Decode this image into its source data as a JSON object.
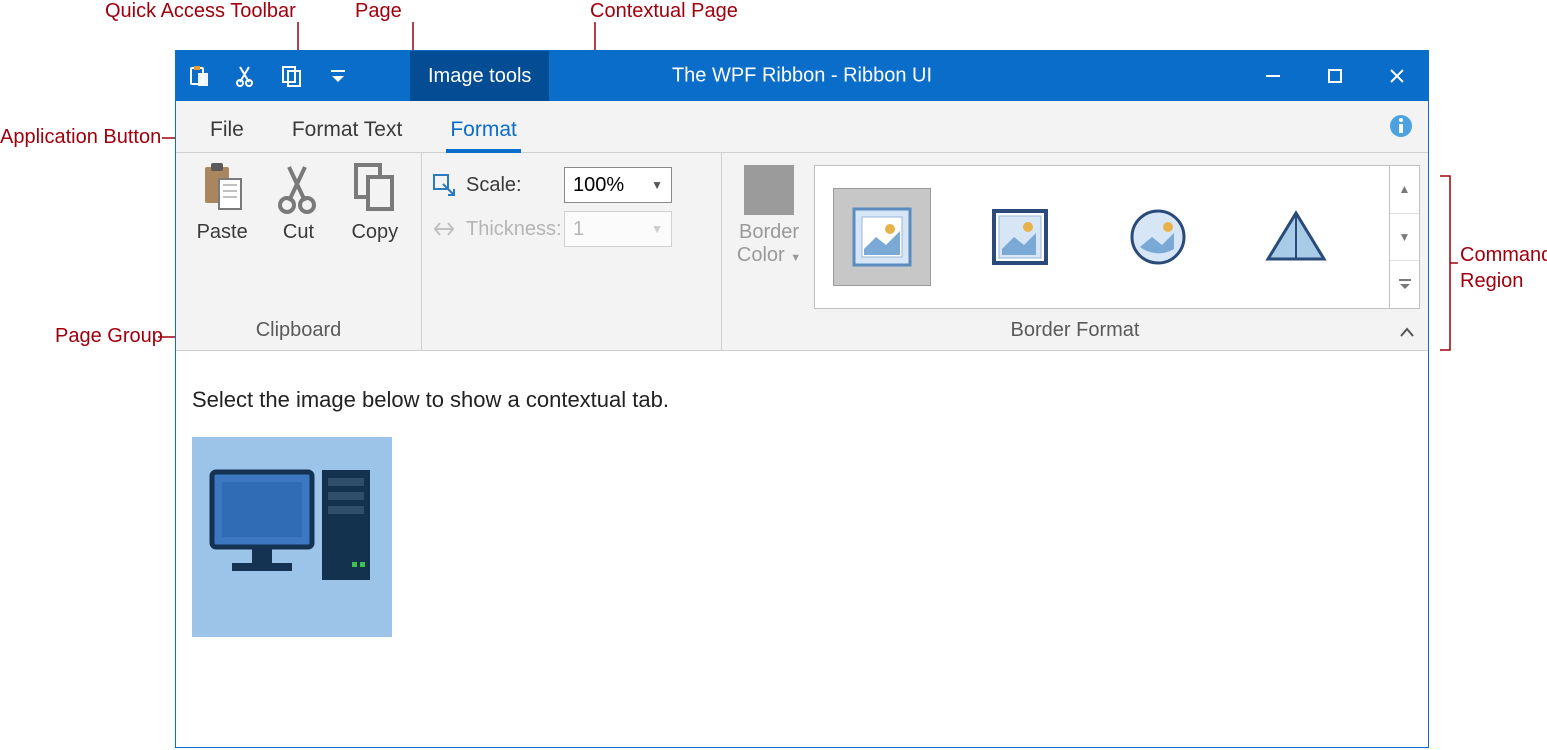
{
  "callouts": {
    "qat": "Quick Access Toolbar",
    "page": "Page",
    "contextual": "Contextual Page",
    "appButton": "Application Button",
    "pageGroup": "Page Group",
    "commandRegion1": "Command",
    "commandRegion2": "Region"
  },
  "titlebar": {
    "contextualLabel": "Image tools",
    "title": "The WPF Ribbon - Ribbon UI"
  },
  "tabs": {
    "file": "File",
    "formatText": "Format Text",
    "format": "Format"
  },
  "groups": {
    "clipboard": {
      "label": "Clipboard",
      "paste": "Paste",
      "cut": "Cut",
      "copy": "Copy"
    },
    "scaleGroup": {
      "scaleLabel": "Scale:",
      "scaleValue": "100%",
      "thicknessLabel": "Thickness:",
      "thicknessValue": "1"
    },
    "borderColor": {
      "label1": "Border",
      "label2": "Color"
    },
    "borderFormat": {
      "label": "Border Format"
    }
  },
  "content": {
    "hint": "Select the image below to show a contextual tab."
  }
}
